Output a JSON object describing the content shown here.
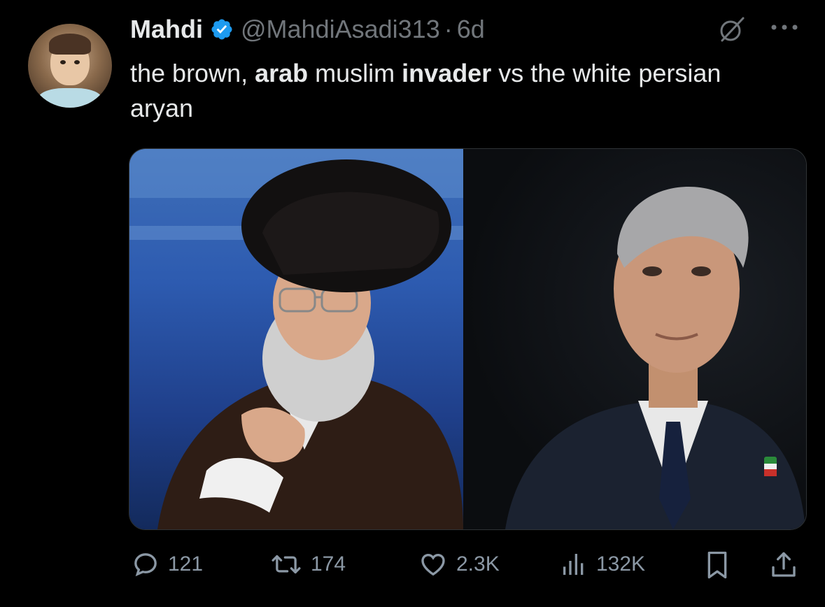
{
  "tweet": {
    "author_name": "Mahdi",
    "handle": "@MahdiAsadi313",
    "separator": "·",
    "time": "6d",
    "text_part1": "the brown, ",
    "text_bold1": "arab",
    "text_part2": " muslim ",
    "text_bold2": "invader",
    "text_part3": " vs the white persian aryan"
  },
  "stats": {
    "replies": "121",
    "reposts": "174",
    "likes": "2.3K",
    "views": "132K"
  },
  "icons": {
    "verified": "verified-badge-icon",
    "grok": "grok-icon",
    "more": "more-icon",
    "reply": "reply-icon",
    "repost": "repost-icon",
    "like": "heart-icon",
    "views": "views-icon",
    "bookmark": "bookmark-icon",
    "share": "share-icon"
  },
  "colors": {
    "background": "#000000",
    "text": "#e7e9ea",
    "muted": "#71767b",
    "verified": "#1d9bf0"
  }
}
